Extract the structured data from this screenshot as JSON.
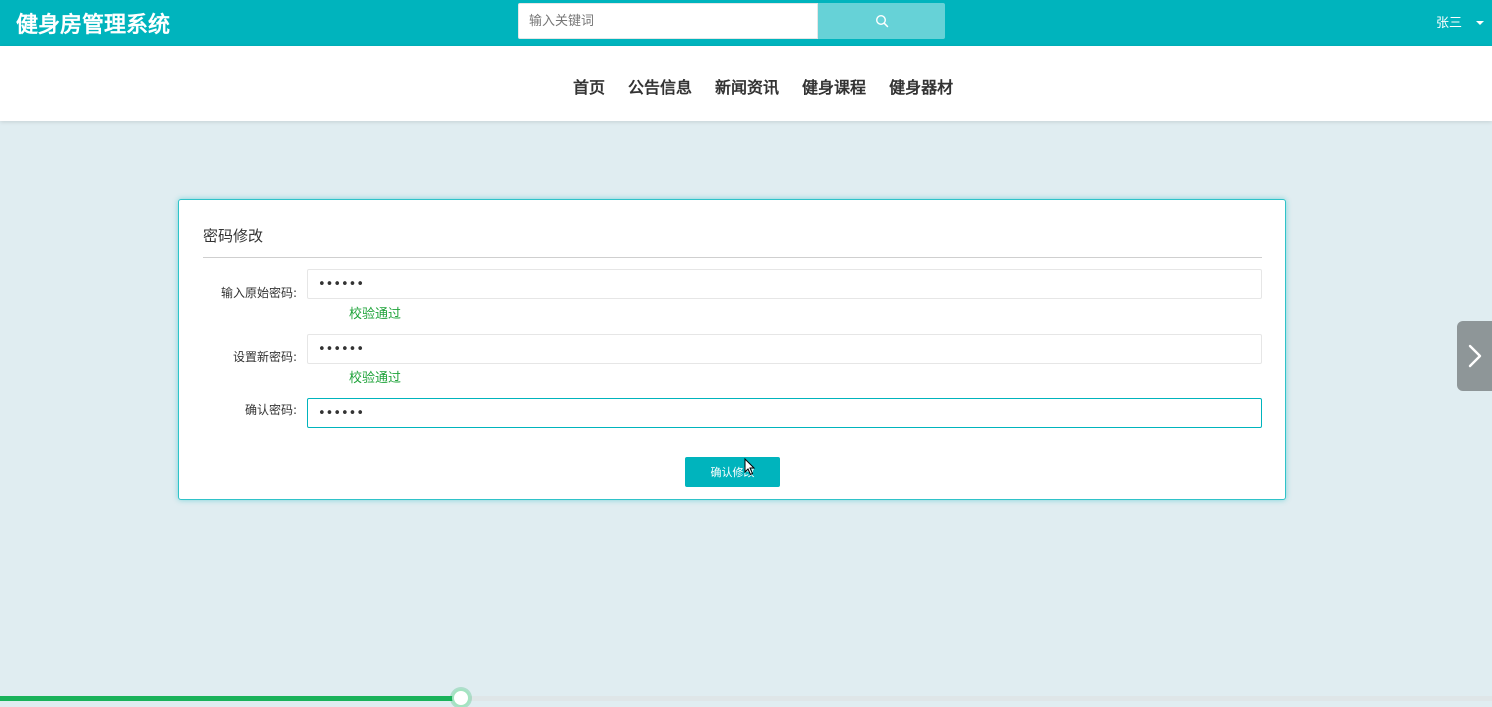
{
  "header": {
    "brand": "健身房管理系统",
    "search": {
      "placeholder": "输入关键词",
      "value": ""
    },
    "search_button_icon": "search-icon",
    "user_name": "张三"
  },
  "nav": {
    "items": [
      {
        "label": "首页"
      },
      {
        "label": "公告信息"
      },
      {
        "label": "新闻资讯"
      },
      {
        "label": "健身课程"
      },
      {
        "label": "健身器材"
      }
    ]
  },
  "form": {
    "title": "密码修改",
    "fields": [
      {
        "label": "输入原始密码:",
        "value": "••••••",
        "validation": "校验通过"
      },
      {
        "label": "设置新密码:",
        "value": "••••••",
        "validation": "校验通过"
      },
      {
        "label": "确认密码:",
        "value": "••••••",
        "validation": ""
      }
    ],
    "submit_label": "确认修改"
  },
  "side_nav": {
    "icon": "chevron-right-icon"
  },
  "progress": {
    "fraction": 0.309
  },
  "colors": {
    "accent": "#00b4bd",
    "search_button": "#66d2d7",
    "valid_text": "#1fa33a",
    "progress_fill": "#19b25a",
    "background": "#e0edf1"
  }
}
